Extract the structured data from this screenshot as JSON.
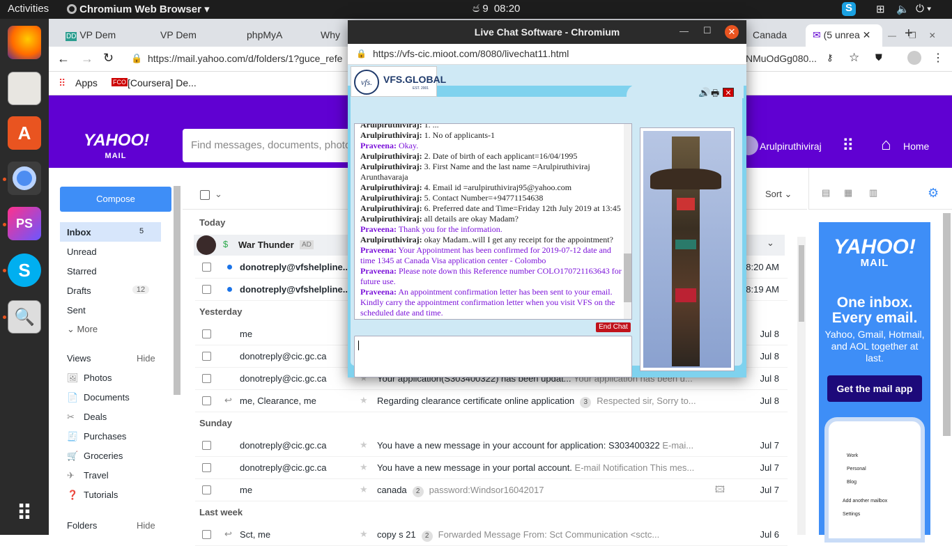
{
  "topbar": {
    "activities": "Activities",
    "app": "Chromium Web Browser",
    "date": "9",
    "time": "08:20"
  },
  "dock": {
    "items": [
      "firefox-icon",
      "files-icon",
      "software-icon",
      "chromium-icon",
      "phpstorm-icon",
      "skype-icon",
      "search-tool-icon",
      "apps-grid-icon"
    ]
  },
  "browser": {
    "tabs": [
      "VP Dem",
      "VP Dem",
      "phpMyA",
      "Why",
      "Canada",
      "(5 unrea"
    ],
    "url": "https://mail.yahoo.com/d/folders/1?guce_refe",
    "url_right": "NMuOdGg080...",
    "bookmarks": {
      "apps": "Apps",
      "coursera": "[Coursera] De..."
    }
  },
  "yahoo": {
    "search_placeholder": "Find messages, documents, photo",
    "user": "Arulpiruthiviraj",
    "home": "Home",
    "compose": "Compose",
    "folders": [
      {
        "label": "Inbox",
        "count": "5"
      },
      {
        "label": "Unread",
        "count": ""
      },
      {
        "label": "Starred",
        "count": ""
      },
      {
        "label": "Drafts",
        "count": "12"
      },
      {
        "label": "Sent",
        "count": ""
      }
    ],
    "more": "More",
    "views": "Views",
    "hide": "Hide",
    "view_items": [
      "Photos",
      "Documents",
      "Deals",
      "Purchases",
      "Groceries",
      "Travel",
      "Tutorials"
    ],
    "folders_label": "Folders",
    "sort": "Sort",
    "groups": [
      "Today",
      "Yesterday",
      "Sunday",
      "Last week"
    ],
    "ad": {
      "from": "War Thunder",
      "tag": "AD"
    },
    "messages": [
      {
        "from": "donotreply@vfshelpline...",
        "subject": "",
        "snippet": "",
        "date": "8:20 AM",
        "unread": true
      },
      {
        "from": "donotreply@vfshelpline...",
        "subject": "",
        "snippet": "",
        "date": "8:19 AM",
        "unread": true
      },
      {
        "from": "me",
        "subject": "",
        "snippet": "",
        "date": "Jul 8"
      },
      {
        "from": "donotreply@cic.gc.ca",
        "subject": "",
        "snippet": "",
        "date": "Jul 8"
      },
      {
        "from": "donotreply@cic.gc.ca",
        "subject": "Your application(S303400322) has been updat...",
        "snippet": "Your application has been u...",
        "date": "Jul 8"
      },
      {
        "from": "me, Clearance, me",
        "subject": "Regarding clearance certificate online application",
        "count": "3",
        "snippet": "Respected sir, Sorry to...",
        "date": "Jul 8"
      },
      {
        "from": "donotreply@cic.gc.ca",
        "subject": "You have a new message in your account for application: S303400322",
        "snippet": "E-mai...",
        "date": "Jul 7"
      },
      {
        "from": "donotreply@cic.gc.ca",
        "subject": "You have a new message in your portal account.",
        "snippet": "E-mail Notification This mes...",
        "date": "Jul 7"
      },
      {
        "from": "me",
        "subject": "canada",
        "count": "2",
        "snippet": "password:Windsor16042017",
        "date": "Jul 7"
      },
      {
        "from": "Sct, me",
        "subject": "copy s 21",
        "count": "2",
        "snippet": "Forwarded Message     From: Sct Communication <sctc...",
        "date": "Jul 6"
      }
    ],
    "ad_panel": {
      "logo1": "YAHOO!",
      "logo2": "MAIL",
      "headline": "One inbox. Every email.",
      "body": "Yahoo, Gmail, Hotmail, and AOL together at last.",
      "cta": "Get the mail app",
      "phone": [
        "Work",
        "Personal",
        "Blog",
        "Add another mailbox",
        "Settings"
      ]
    }
  },
  "chat": {
    "window_title": "Live Chat Software - Chromium",
    "url": "https://vfs-cic.mioot.com/8080/livechat11.html",
    "brand": "VFS.GLOBAL",
    "brand_sub": "EST. 2001",
    "logo_mark": "vfs.",
    "end_chat": "End Chat",
    "messages": [
      {
        "who": "Arulpiruthiviraj:",
        "text": "1. No of applicants-1",
        "agent": false
      },
      {
        "who": "Praveena:",
        "text": "Okay.",
        "agent": true
      },
      {
        "who": "Arulpiruthiviraj:",
        "text": "2. Date of birth of each applicant=16/04/1995",
        "agent": false
      },
      {
        "who": "Arulpiruthiviraj:",
        "text": "3. First Name and the last name =Arulpiruthiviraj Arunthavaraja",
        "agent": false
      },
      {
        "who": "Arulpiruthiviraj:",
        "text": "4. Email id =arulpiruthiviraj95@yahoo.com",
        "agent": false
      },
      {
        "who": "Arulpiruthiviraj:",
        "text": "5. Contact Number=+94771154638",
        "agent": false
      },
      {
        "who": "Arulpiruthiviraj:",
        "text": "6. Preferred date and Time=Friday 12th July 2019 at 13:45",
        "agent": false
      },
      {
        "who": "Arulpiruthiviraj:",
        "text": "all details are okay Madam?",
        "agent": false
      },
      {
        "who": "Praveena:",
        "text": "Thank you for the information.",
        "agent": true
      },
      {
        "who": "Arulpiruthiviraj:",
        "text": "okay Madam..will I get any receipt for the appointment?",
        "agent": false
      },
      {
        "who": "Praveena:",
        "text": "Your Appointment has been confirmed for 2019-07-12 date and time 1345 at Canada Visa application center - Colombo",
        "agent": true
      },
      {
        "who": "Praveena:",
        "text": "Please note down this Reference number COLO170721163643 for future use.",
        "agent": true
      },
      {
        "who": "Praveena:",
        "text": "An appointment confirmation letter has been sent to your email. Kindly carry the appointment confirmation letter when you visit VFS on the scheduled date and time.",
        "agent": true
      }
    ]
  }
}
